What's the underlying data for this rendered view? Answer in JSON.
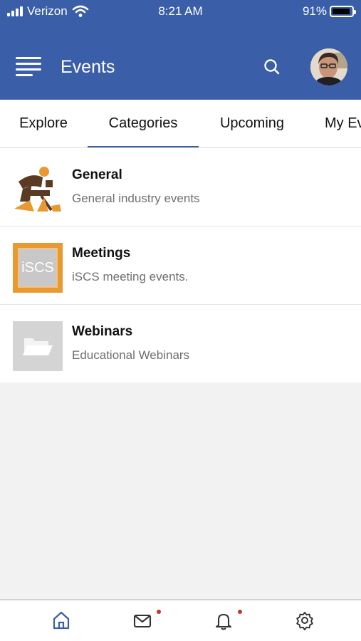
{
  "status_bar": {
    "carrier": "Verizon",
    "time": "8:21 AM",
    "battery": "91%",
    "battery_level": 0.91
  },
  "app_bar": {
    "title": "Events",
    "menu_icon": "hamburger-menu-icon",
    "search_icon": "search-icon",
    "avatar_icon": "user-avatar"
  },
  "tabs": [
    {
      "label": "Explore",
      "active": false
    },
    {
      "label": "Categories",
      "active": true
    },
    {
      "label": "Upcoming",
      "active": false
    },
    {
      "label": "My Ev",
      "active": false
    }
  ],
  "categories": [
    {
      "title": "General",
      "subtitle": "General industry events",
      "thumb": "industry-worker-logo"
    },
    {
      "title": "Meetings",
      "subtitle": "iSCS meeting events.",
      "thumb": "iscs-logo",
      "thumb_text": "iSCS"
    },
    {
      "title": "Webinars",
      "subtitle": "Educational Webinars",
      "thumb": "folder-icon"
    }
  ],
  "bottom_nav": [
    {
      "icon": "home-icon",
      "active": true,
      "badge": false
    },
    {
      "icon": "mail-icon",
      "active": false,
      "badge": true
    },
    {
      "icon": "bell-icon",
      "active": false,
      "badge": true
    },
    {
      "icon": "gear-icon",
      "active": false,
      "badge": false
    }
  ],
  "colors": {
    "header": "#3a5ea8",
    "active_tab": "#3a5ea8",
    "badge": "#c0392b",
    "background": "#f2f2f2",
    "logo_orange": "#e8992f"
  }
}
